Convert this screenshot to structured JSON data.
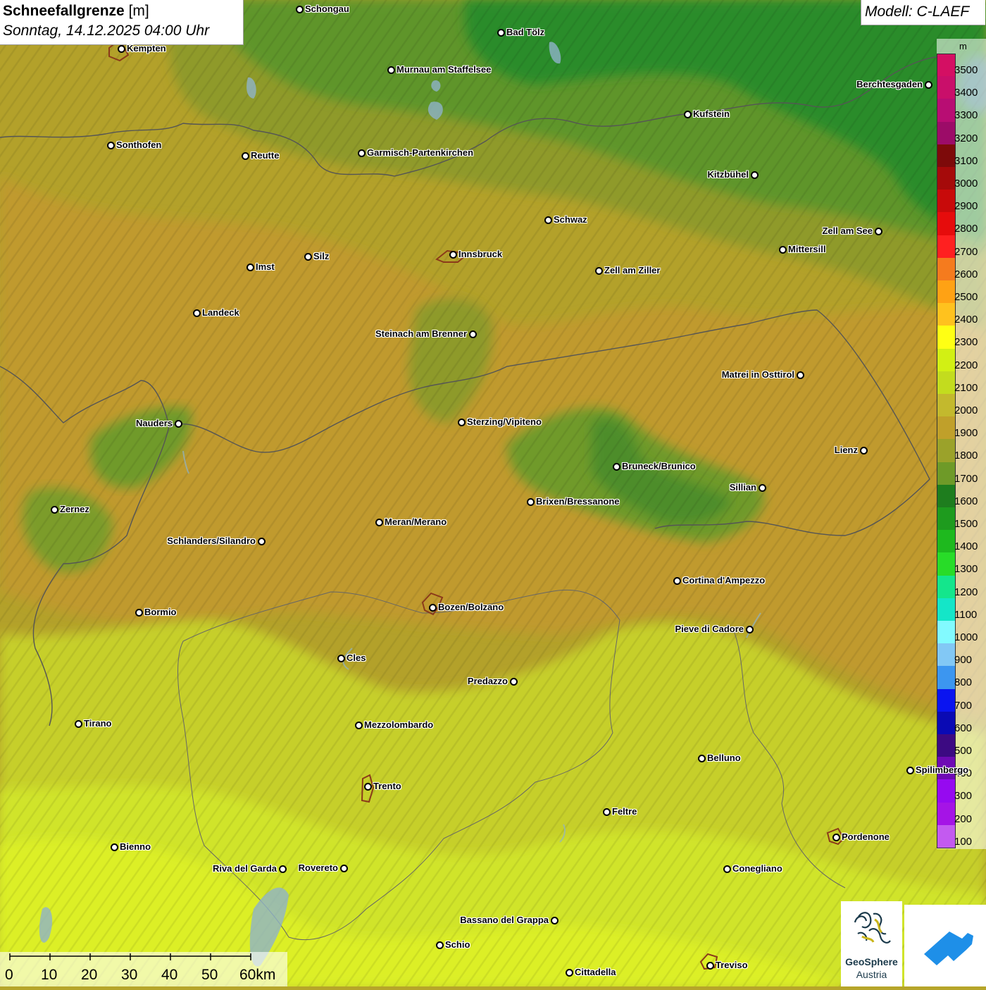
{
  "title": {
    "parameter": "Schneefallgrenze",
    "unit": "[m]",
    "datetime": "Sonntag, 14.12.2025 04:00 Uhr"
  },
  "model": "Modell: C-LAEF",
  "legend": {
    "unit": "m",
    "levels": [
      {
        "value": "3500",
        "color": "#d40f63"
      },
      {
        "value": "3400",
        "color": "#c90f6a"
      },
      {
        "value": "3300",
        "color": "#b80d73"
      },
      {
        "value": "3200",
        "color": "#9c0c68"
      },
      {
        "value": "3100",
        "color": "#7d0a0a"
      },
      {
        "value": "3000",
        "color": "#a50a0a"
      },
      {
        "value": "2900",
        "color": "#c80a0a"
      },
      {
        "value": "2800",
        "color": "#e60c0c"
      },
      {
        "value": "2700",
        "color": "#ff2020"
      },
      {
        "value": "2600",
        "color": "#f57b1e"
      },
      {
        "value": "2500",
        "color": "#ffa214"
      },
      {
        "value": "2400",
        "color": "#ffc21e"
      },
      {
        "value": "2300",
        "color": "#ffff14"
      },
      {
        "value": "2200",
        "color": "#d2f014"
      },
      {
        "value": "2100",
        "color": "#c3dc1e"
      },
      {
        "value": "2000",
        "color": "#c3b92d"
      },
      {
        "value": "1900",
        "color": "#c0a02a"
      },
      {
        "value": "1800",
        "color": "#9ba22a"
      },
      {
        "value": "1700",
        "color": "#6e9a28"
      },
      {
        "value": "1600",
        "color": "#1e7d1e"
      },
      {
        "value": "1500",
        "color": "#1e9b1e"
      },
      {
        "value": "1400",
        "color": "#1eb91e"
      },
      {
        "value": "1300",
        "color": "#28dc28"
      },
      {
        "value": "1200",
        "color": "#14e68c"
      },
      {
        "value": "1100",
        "color": "#14e6c8"
      },
      {
        "value": "1000",
        "color": "#82faff"
      },
      {
        "value": "900",
        "color": "#82c8f5"
      },
      {
        "value": "800",
        "color": "#3c96f0"
      },
      {
        "value": "700",
        "color": "#0a14f0"
      },
      {
        "value": "600",
        "color": "#0a0ab4"
      },
      {
        "value": "500",
        "color": "#3c0a82"
      },
      {
        "value": "400",
        "color": "#6e0ab4"
      },
      {
        "value": "300",
        "color": "#960af0"
      },
      {
        "value": "200",
        "color": "#a514e6"
      },
      {
        "value": "100",
        "color": "#c35af0"
      }
    ]
  },
  "cities": [
    {
      "name": "Schongau",
      "side": "right"
    },
    {
      "name": "Bad Tölz",
      "side": "right"
    },
    {
      "name": "Kempten",
      "side": "right"
    },
    {
      "name": "Murnau am Staffelsee",
      "side": "right"
    },
    {
      "name": "Berchtesgaden",
      "side": "left"
    },
    {
      "name": "Kufstein",
      "side": "right"
    },
    {
      "name": "Sonthofen",
      "side": "right"
    },
    {
      "name": "Reutte",
      "side": "right"
    },
    {
      "name": "Garmisch-Partenkirchen",
      "side": "right"
    },
    {
      "name": "Kitzbühel",
      "side": "left"
    },
    {
      "name": "Schwaz",
      "side": "right"
    },
    {
      "name": "Zell am See",
      "side": "left"
    },
    {
      "name": "Mittersill",
      "side": "right"
    },
    {
      "name": "Innsbruck",
      "side": "right"
    },
    {
      "name": "Silz",
      "side": "right"
    },
    {
      "name": "Imst",
      "side": "right"
    },
    {
      "name": "Zell am Ziller",
      "side": "right"
    },
    {
      "name": "Landeck",
      "side": "right"
    },
    {
      "name": "Steinach am Brenner",
      "side": "left"
    },
    {
      "name": "Matrei in Osttirol",
      "side": "left"
    },
    {
      "name": "Nauders",
      "side": "left"
    },
    {
      "name": "Sterzing/Vipiteno",
      "side": "right"
    },
    {
      "name": "Lienz",
      "side": "left"
    },
    {
      "name": "Bruneck/Brunico",
      "side": "right"
    },
    {
      "name": "Sillian",
      "side": "left"
    },
    {
      "name": "Brixen/Bressanone",
      "side": "right"
    },
    {
      "name": "Zernez",
      "side": "right"
    },
    {
      "name": "Meran/Merano",
      "side": "right"
    },
    {
      "name": "Schlanders/Silandro",
      "side": "left"
    },
    {
      "name": "Cortina d'Ampezzo",
      "side": "right"
    },
    {
      "name": "Bozen/Bolzano",
      "side": "right"
    },
    {
      "name": "Bormio",
      "side": "right"
    },
    {
      "name": "Pieve di Cadore",
      "side": "left"
    },
    {
      "name": "Cles",
      "side": "right"
    },
    {
      "name": "Predazzo",
      "side": "left"
    },
    {
      "name": "Tirano",
      "side": "right"
    },
    {
      "name": "Mezzolombardo",
      "side": "right"
    },
    {
      "name": "Belluno",
      "side": "right"
    },
    {
      "name": "Spilimbergo",
      "side": "right"
    },
    {
      "name": "Trento",
      "side": "right"
    },
    {
      "name": "Feltre",
      "side": "right"
    },
    {
      "name": "Pordenone",
      "side": "right"
    },
    {
      "name": "Bienno",
      "side": "right"
    },
    {
      "name": "Riva del Garda",
      "side": "left"
    },
    {
      "name": "Rovereto",
      "side": "left"
    },
    {
      "name": "Conegliano",
      "side": "right"
    },
    {
      "name": "Bassano del Grappa",
      "side": "left"
    },
    {
      "name": "Schio",
      "side": "right"
    },
    {
      "name": "Treviso",
      "side": "right"
    },
    {
      "name": "Cittadella",
      "side": "right"
    }
  ],
  "scalebar": {
    "labels": [
      "0",
      "10",
      "20",
      "30",
      "40",
      "50",
      "60km"
    ]
  },
  "logos": {
    "geosphere_name": "GeoSphere",
    "geosphere_sub": "Austria"
  }
}
